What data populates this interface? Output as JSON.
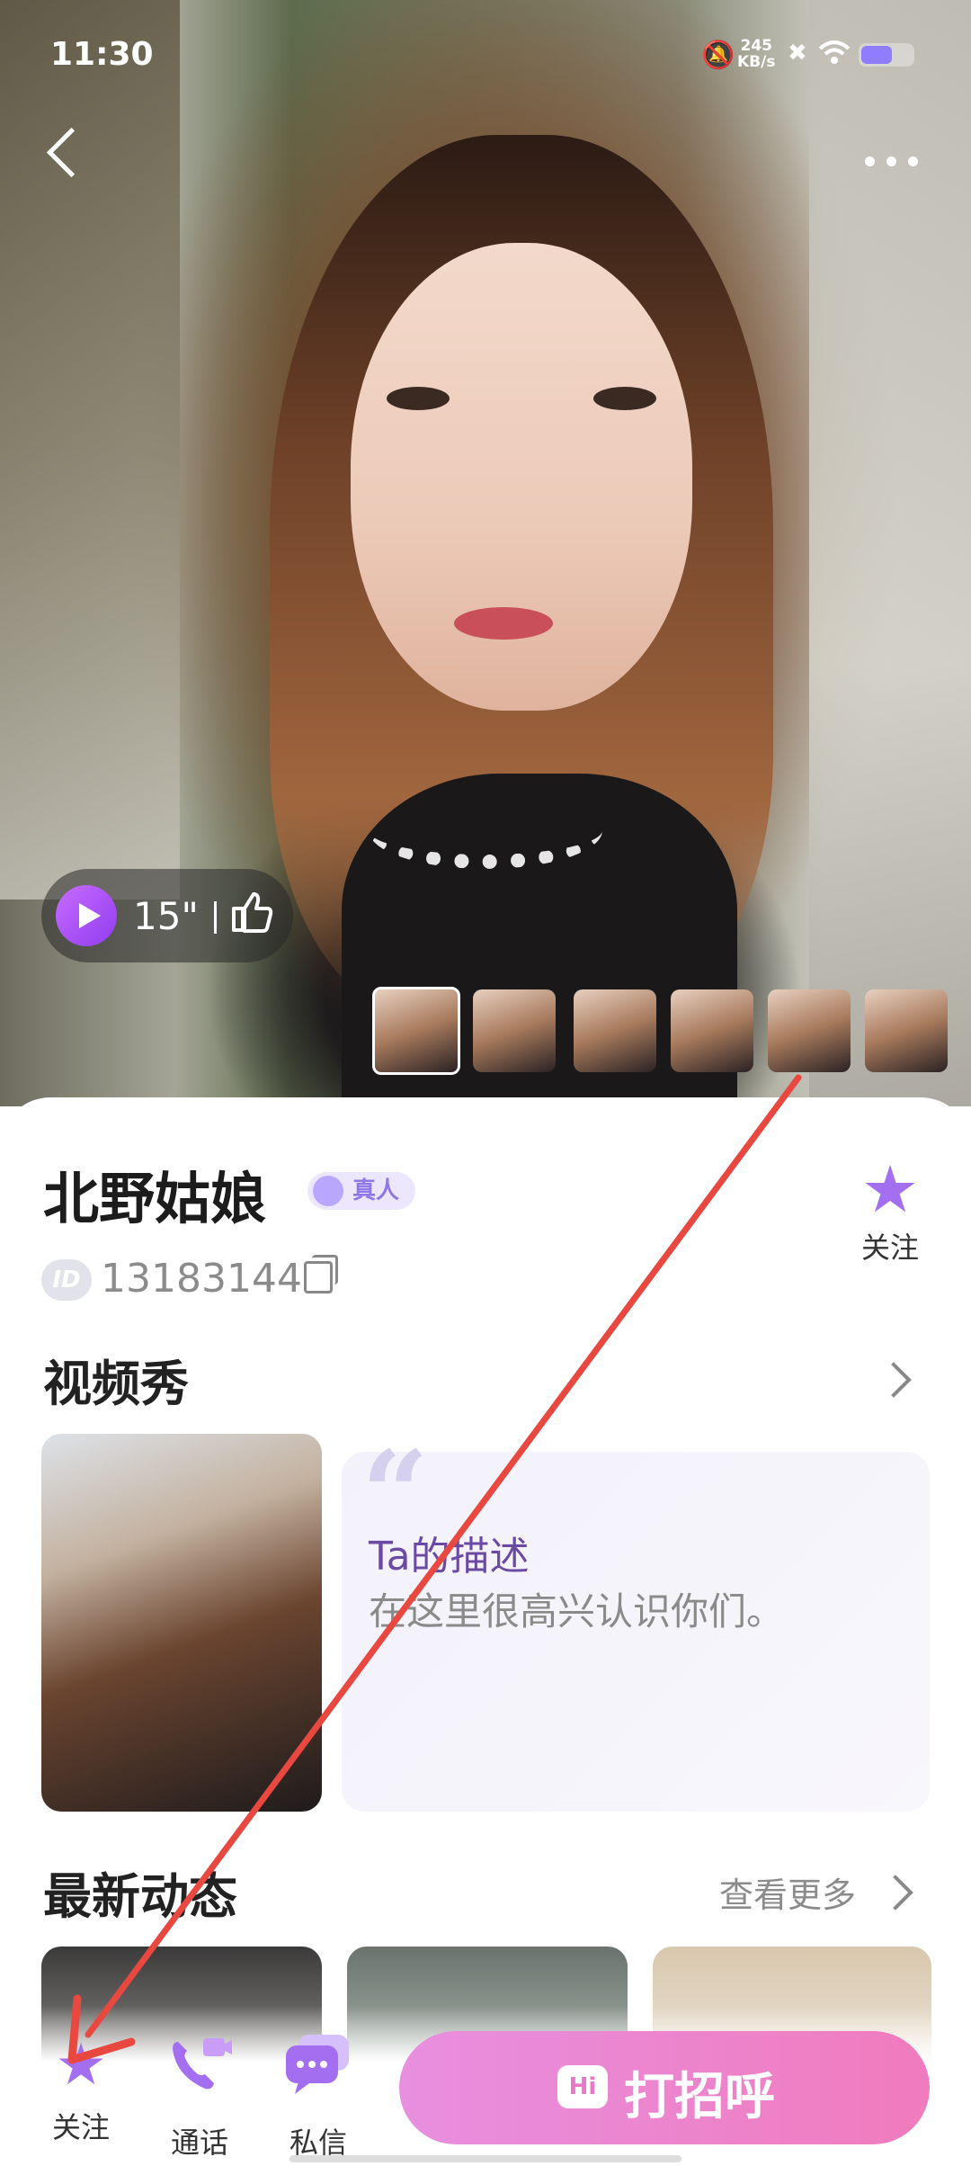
{
  "status_bar": {
    "time": "11:30",
    "net_speed_value": "245",
    "net_speed_unit": "KB/s",
    "battery_level": 0.6
  },
  "hero": {
    "video_duration": "15\"",
    "thumbnail_count": 6,
    "selected_thumbnail_index": 0
  },
  "profile": {
    "name": "北野姑娘",
    "verified_badge": "真人",
    "id_badge": "ID",
    "id_number": "13183144",
    "follow_label": "关注"
  },
  "video_show": {
    "title": "视频秀",
    "desc_title": "Ta的描述",
    "desc_text": "在这里很高兴认识你们。",
    "quote_mark": "“"
  },
  "moments": {
    "title": "最新动态",
    "more_label": "查看更多"
  },
  "bottom_bar": {
    "follow_label": "关注",
    "call_label": "通话",
    "message_label": "私信",
    "greet_badge": "Hi",
    "greet_label": "打招呼"
  },
  "colors": {
    "accent_purple": "#a46ef0",
    "greet_gradient_start": "#e88fdf",
    "greet_gradient_end": "#f07bbd",
    "annotation_arrow": "#e8483f"
  },
  "icons": {
    "back": "chevron-left-icon",
    "more": "more-dots-icon",
    "play": "play-icon",
    "like": "thumbs-up-icon",
    "star": "star-icon",
    "copy": "copy-icon",
    "call": "video-call-icon",
    "message": "chat-bubble-icon"
  }
}
